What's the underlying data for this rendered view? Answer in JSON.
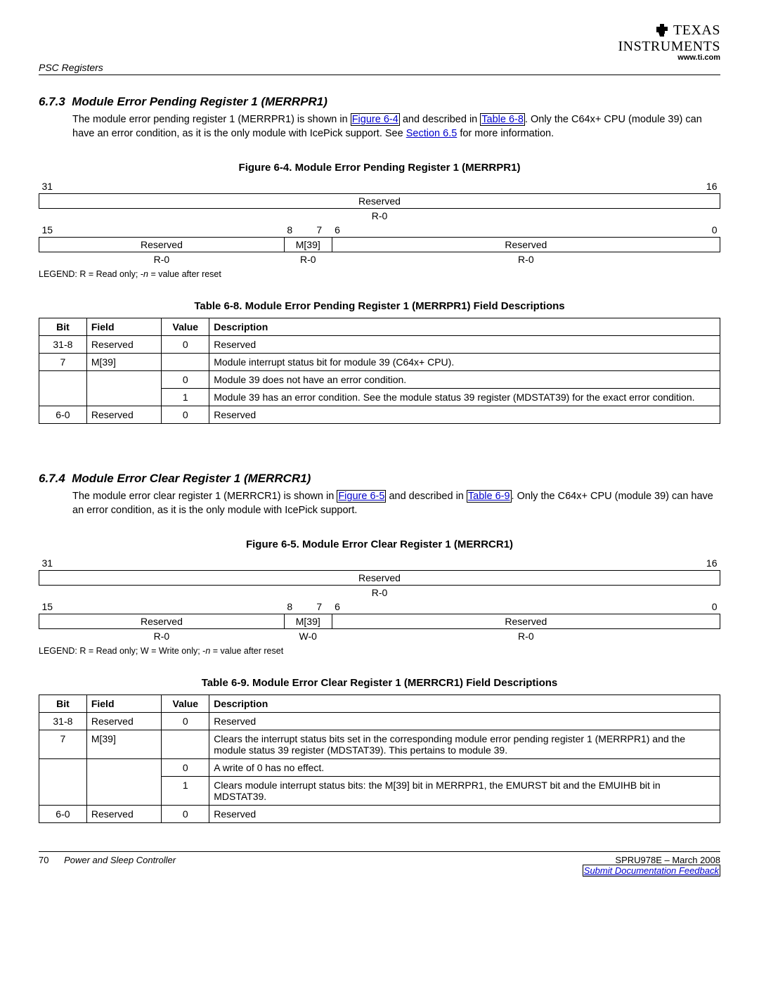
{
  "header": {
    "section_label": "PSC Registers",
    "logo_top": "TEXAS",
    "logo_bottom": "INSTRUMENTS",
    "url": "www.ti.com"
  },
  "sec673": {
    "number": "6.7.3",
    "title": "Module Error Pending Register 1 (MERRPR1)",
    "para_a": "The module error pending register 1 (MERRPR1) is shown in ",
    "link_fig": "Figure 6-4",
    "para_b": " and described in ",
    "link_tab": "Table 6-8",
    "para_c": ". Only the C64x+ CPU (module 39) can have an error condition, as it is the only module with IcePick support. See ",
    "link_sec": "Section 6.5",
    "para_d": " for more information.",
    "fig_caption": "Figure 6-4. Module Error Pending Register 1 (MERRPR1)",
    "bits": {
      "b31": "31",
      "b16": "16",
      "r1_reserved": "Reserved",
      "r1_ro": "R-0",
      "b15": "15",
      "b8": "8",
      "b7": "7",
      "b6": "6",
      "b0": "0",
      "r2_reserved_l": "Reserved",
      "r2_m39": "M[39]",
      "r2_reserved_r": "Reserved",
      "r2_ro_l": "R-0",
      "r2_ro_m": "R-0",
      "r2_ro_r": "R-0"
    },
    "legend_a": "LEGEND: R = Read only; -",
    "legend_n": "n",
    "legend_b": " = value after reset",
    "tab_caption": "Table 6-8. Module Error Pending Register 1 (MERRPR1) Field Descriptions",
    "th_bit": "Bit",
    "th_field": "Field",
    "th_value": "Value",
    "th_desc": "Description",
    "row1": {
      "bit": "31-8",
      "field": "Reserved",
      "value": "0",
      "desc": "Reserved"
    },
    "row2": {
      "bit": "7",
      "field": "M[39]",
      "value": "",
      "desc": "Module interrupt status bit for module 39 (C64x+ CPU)."
    },
    "row3": {
      "value": "0",
      "desc": "Module 39 does not have an error condition."
    },
    "row4": {
      "value": "1",
      "desc": "Module 39 has an error condition. See the module status 39 register (MDSTAT39) for the exact error condition."
    },
    "row5": {
      "bit": "6-0",
      "field": "Reserved",
      "value": "0",
      "desc": "Reserved"
    }
  },
  "sec674": {
    "number": "6.7.4",
    "title": "Module Error Clear Register 1 (MERRCR1)",
    "para_a": "The module error clear register 1 (MERRCR1) is shown in ",
    "link_fig": "Figure 6-5",
    "para_b": " and described in ",
    "link_tab": "Table 6-9",
    "para_c": ". Only the C64x+ CPU (module 39) can have an error condition, as it is the only module with IcePick support.",
    "fig_caption": "Figure 6-5. Module Error Clear Register 1 (MERRCR1)",
    "bits": {
      "b31": "31",
      "b16": "16",
      "r1_reserved": "Reserved",
      "r1_ro": "R-0",
      "b15": "15",
      "b8": "8",
      "b7": "7",
      "b6": "6",
      "b0": "0",
      "r2_reserved_l": "Reserved",
      "r2_m39": "M[39]",
      "r2_reserved_r": "Reserved",
      "r2_ro_l": "R-0",
      "r2_wo_m": "W-0",
      "r2_ro_r": "R-0"
    },
    "legend_a": "LEGEND: R = Read only; W = Write only; -",
    "legend_n": "n",
    "legend_b": " = value after reset",
    "tab_caption": "Table 6-9. Module Error Clear Register 1 (MERRCR1) Field Descriptions",
    "row1": {
      "bit": "31-8",
      "field": "Reserved",
      "value": "0",
      "desc": "Reserved"
    },
    "row2": {
      "bit": "7",
      "field": "M[39]",
      "value": "",
      "desc": "Clears the interrupt status bits set in the corresponding module error pending register 1 (MERRPR1) and the module status 39 register (MDSTAT39). This pertains to module 39."
    },
    "row3": {
      "value": "0",
      "desc": "A write of 0 has no effect."
    },
    "row4": {
      "value": "1",
      "desc": "Clears module interrupt status bits: the M[39] bit in MERRPR1, the EMURST bit and the EMUIHB bit in MDSTAT39."
    },
    "row5": {
      "bit": "6-0",
      "field": "Reserved",
      "value": "0",
      "desc": "Reserved"
    }
  },
  "footer": {
    "page": "70",
    "title": "Power and Sleep Controller",
    "docid": "SPRU978E – March 2008",
    "feedback": "Submit Documentation Feedback"
  }
}
